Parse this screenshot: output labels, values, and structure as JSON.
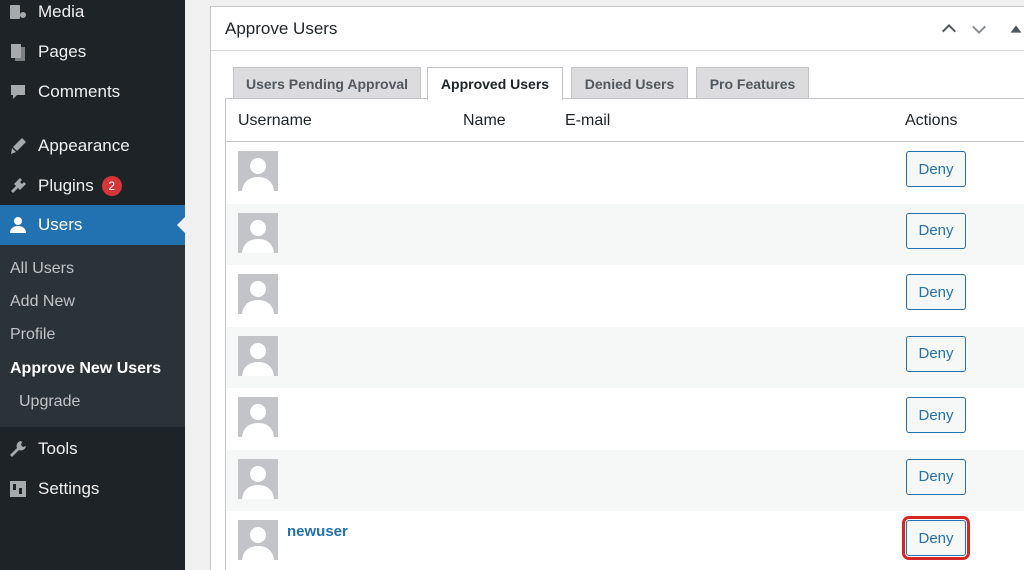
{
  "sidebar": {
    "items": [
      {
        "label": "Media",
        "icon": "media-icon"
      },
      {
        "label": "Pages",
        "icon": "pages-icon"
      },
      {
        "label": "Comments",
        "icon": "comments-icon"
      },
      {
        "label": "Appearance",
        "icon": "appearance-icon"
      },
      {
        "label": "Plugins",
        "icon": "plugins-icon",
        "badge": "2"
      },
      {
        "label": "Users",
        "icon": "users-icon",
        "active": true
      },
      {
        "label": "Tools",
        "icon": "tools-icon"
      },
      {
        "label": "Settings",
        "icon": "settings-icon"
      }
    ],
    "submenu": [
      {
        "label": "All Users"
      },
      {
        "label": "Add New"
      },
      {
        "label": "Profile"
      },
      {
        "label": "Approve New Users",
        "current": true
      },
      {
        "label": "Upgrade"
      }
    ],
    "active_color": "#2271b1",
    "badge_color": "#d63638"
  },
  "panel": {
    "title": "Approve Users",
    "tabs": [
      {
        "label": "Users Pending Approval"
      },
      {
        "label": "Approved Users",
        "active": true
      },
      {
        "label": "Denied Users"
      },
      {
        "label": "Pro Features"
      }
    ],
    "columns": [
      "Username",
      "Name",
      "E-mail",
      "Actions"
    ],
    "rows": [
      {
        "username": "",
        "action": "Deny"
      },
      {
        "username": "",
        "action": "Deny"
      },
      {
        "username": "",
        "action": "Deny"
      },
      {
        "username": "",
        "action": "Deny"
      },
      {
        "username": "",
        "action": "Deny"
      },
      {
        "username": "",
        "action": "Deny"
      },
      {
        "username": "newuser",
        "action": "Deny",
        "highlighted": true
      }
    ],
    "highlight_color": "#d62728"
  }
}
